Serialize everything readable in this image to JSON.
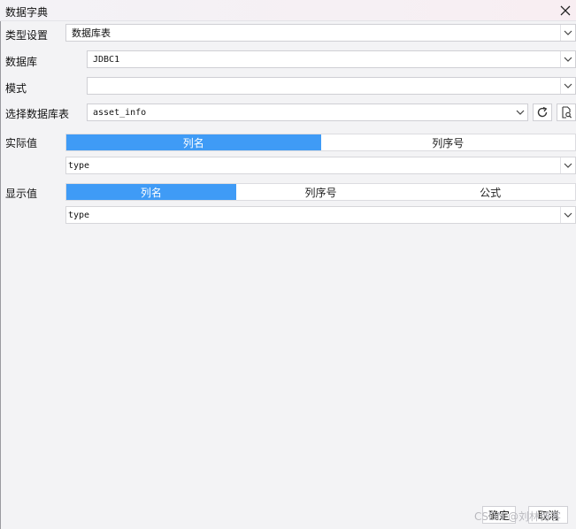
{
  "dialog": {
    "title": "数据字典"
  },
  "form": {
    "type_label": "类型设置",
    "type_value": "数据库表",
    "database_label": "数据库",
    "database_value": "JDBC1",
    "schema_label": "模式",
    "schema_value": "",
    "table_label": "选择数据库表",
    "table_value": "asset_info"
  },
  "actual_value": {
    "label": "实际值",
    "tabs": [
      "列名",
      "列序号"
    ],
    "active_tab": 0,
    "value": "type"
  },
  "display_value": {
    "label": "显示值",
    "tabs": [
      "列名",
      "列序号",
      "公式"
    ],
    "active_tab": 0,
    "value": "type"
  },
  "footer": {
    "ok_label": "确定",
    "cancel_label": "取消",
    "watermark": "CSDN @刘林博客"
  },
  "icons": {
    "close": "close-icon",
    "dropdown": "chevron-down-icon",
    "refresh": "refresh-icon",
    "preview": "document-search-icon"
  },
  "colors": {
    "accent": "#3f9bf6",
    "background": "#f3f3f5"
  }
}
